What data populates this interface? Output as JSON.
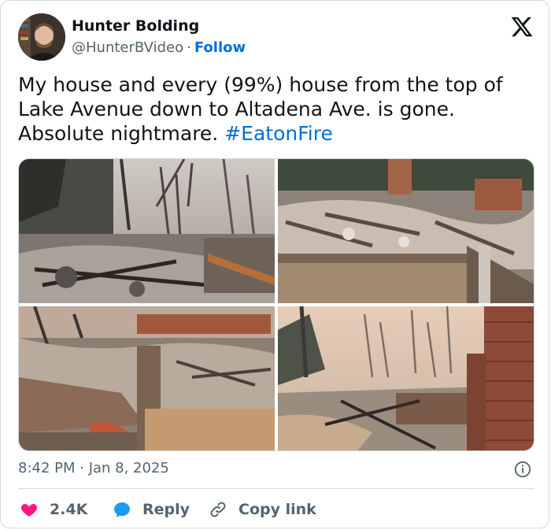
{
  "author": {
    "name": "Hunter Bolding",
    "handle": "@HunterBVideo",
    "separator": "·",
    "follow_label": "Follow"
  },
  "platform_icon": "x-logo-icon",
  "tweet": {
    "text": "My house and every (99%) house from the top of Lake Avenue down to Altadena Ave. is gone. Absolute nightmare. ",
    "hashtag": "#EatonFire"
  },
  "media": {
    "photos": [
      {
        "icon": "photo-burned-street"
      },
      {
        "icon": "photo-house-rubble"
      },
      {
        "icon": "photo-debris-yard"
      },
      {
        "icon": "photo-brick-chimney-ruins"
      }
    ]
  },
  "timestamp": "8:42 PM · Jan 8, 2025",
  "actions": {
    "like_count": "2.4K",
    "reply_label": "Reply",
    "copy_label": "Copy link"
  },
  "colors": {
    "accent": "#006fd6",
    "text": "#0f1419",
    "muted": "#536471",
    "like": "#f91880",
    "reply": "#1d9bf0",
    "border": "#cfd9de"
  }
}
